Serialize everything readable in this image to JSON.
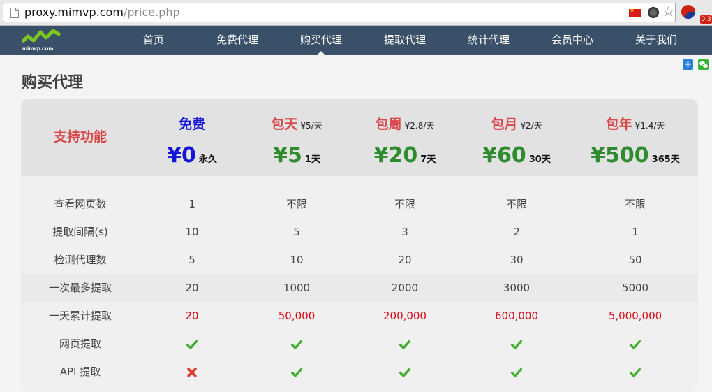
{
  "browser": {
    "url_host": "proxy.mimvp.com",
    "url_path": "/price.php",
    "badge": "0.3"
  },
  "nav": {
    "logo_text": "mimvp.com",
    "items": [
      "首页",
      "免费代理",
      "购买代理",
      "提取代理",
      "统计代理",
      "会员中心",
      "关于我们"
    ],
    "active_index": 2
  },
  "share": {
    "plus_label": "+"
  },
  "page_title": "购买代理",
  "pricing": {
    "feature_header": "支持功能",
    "plans": [
      {
        "name": "免费",
        "unit": "",
        "price": "¥0",
        "duration": "永久",
        "color": "#1515d6"
      },
      {
        "name": "包天",
        "unit": "¥5/天",
        "price": "¥5",
        "duration": "1天",
        "color": "#2e8b2e"
      },
      {
        "name": "包周",
        "unit": "¥2.8/天",
        "price": "¥20",
        "duration": "7天",
        "color": "#2e8b2e"
      },
      {
        "name": "包月",
        "unit": "¥2/天",
        "price": "¥60",
        "duration": "30天",
        "color": "#2e8b2e"
      },
      {
        "name": "包年",
        "unit": "¥1.4/天",
        "price": "¥500",
        "duration": "365天",
        "color": "#2e8b2e"
      }
    ],
    "plan_name_color_paid": "#d9484b",
    "rows": [
      {
        "label": "查看网页数",
        "values": [
          "1",
          "不限",
          "不限",
          "不限",
          "不限"
        ],
        "red": false
      },
      {
        "label": "提取间隔(s)",
        "values": [
          "10",
          "5",
          "3",
          "2",
          "1"
        ],
        "red": false
      },
      {
        "label": "检测代理数",
        "values": [
          "5",
          "10",
          "20",
          "30",
          "50"
        ],
        "red": false
      },
      {
        "label": "一次最多提取",
        "values": [
          "20",
          "1000",
          "2000",
          "3000",
          "5000"
        ],
        "red": false
      },
      {
        "label": "一天累计提取",
        "values": [
          "20",
          "50,000",
          "200,000",
          "600,000",
          "5,000,000"
        ],
        "red": true
      },
      {
        "label": "网页提取",
        "icons": [
          "check-icon",
          "check-icon",
          "check-icon",
          "check-icon",
          "check-icon"
        ]
      },
      {
        "label": "API 提取",
        "icons": [
          "cross-icon",
          "check-icon",
          "check-icon",
          "check-icon",
          "check-icon"
        ]
      }
    ]
  }
}
